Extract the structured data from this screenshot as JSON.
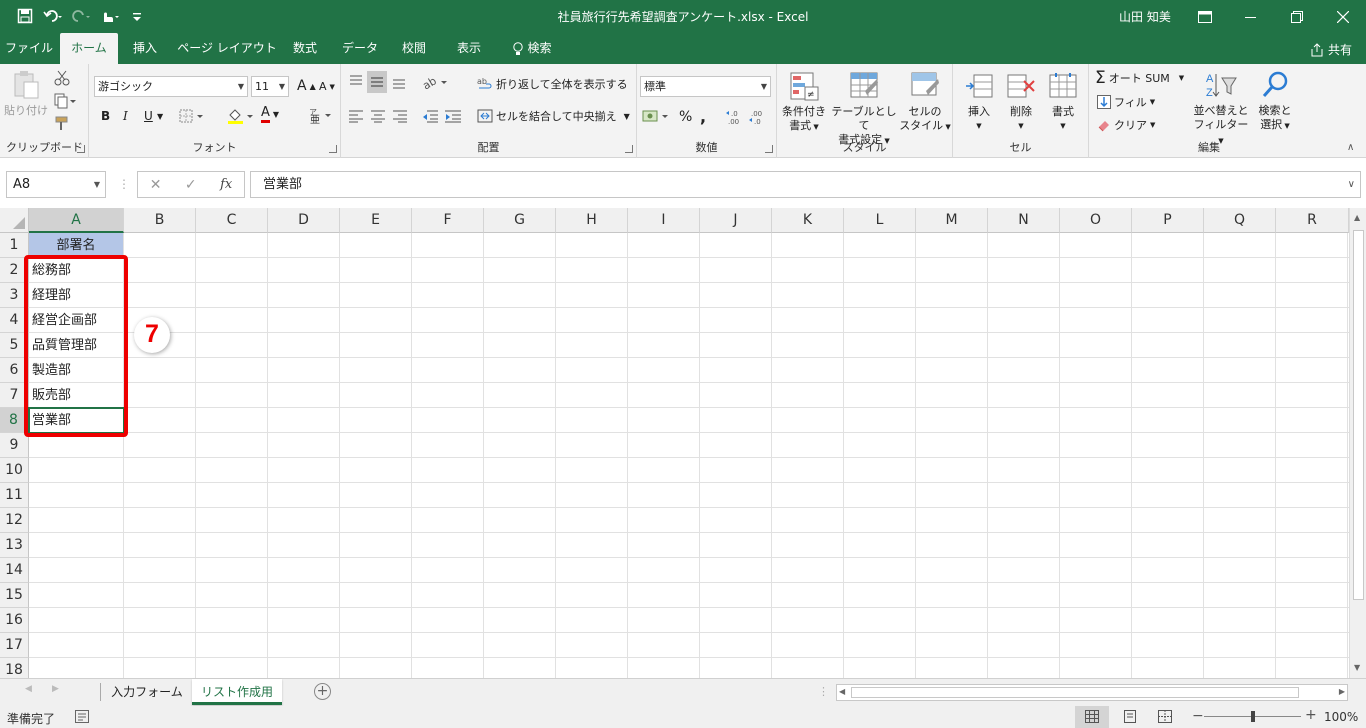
{
  "window": {
    "title": "社員旅行行先希望調査アンケート.xlsx  -  Excel",
    "user": "山田 知美",
    "share_label": "共有"
  },
  "tabs": [
    "ファイル",
    "ホーム",
    "挿入",
    "ページ レイアウト",
    "数式",
    "データ",
    "校閲",
    "表示",
    "検索"
  ],
  "ribbon": {
    "clipboard": {
      "label": "クリップボード",
      "paste": "貼り付け"
    },
    "font": {
      "label": "フォント",
      "name": "游ゴシック",
      "size": "11",
      "bold": "B",
      "italic": "I",
      "underline": "U",
      "grow": "A",
      "shrink": "A",
      "font_color": "A"
    },
    "alignment": {
      "label": "配置",
      "wrap": "折り返して全体を表示する",
      "merge": "セルを結合して中央揃え"
    },
    "number": {
      "label": "数値",
      "format": "標準",
      "percent": "%",
      "comma": ","
    },
    "styles": {
      "label": "スタイル",
      "conditional": [
        "条件付き",
        "書式"
      ],
      "table": [
        "テーブルとして",
        "書式設定"
      ],
      "cell_styles": [
        "セルの",
        "スタイル"
      ]
    },
    "cells": {
      "label": "セル",
      "insert": "挿入",
      "delete": "削除",
      "format": "書式"
    },
    "editing": {
      "label": "編集",
      "autosum": "オート SUM",
      "fill": "フィル",
      "clear": "クリア",
      "sort": [
        "並べ替えと",
        "フィルター"
      ],
      "find": [
        "検索と",
        "選択"
      ]
    }
  },
  "formula_bar": {
    "name_box": "A8",
    "fx": "fx",
    "content": "営業部"
  },
  "columns": [
    "A",
    "B",
    "C",
    "D",
    "E",
    "F",
    "G",
    "H",
    "I",
    "J",
    "K",
    "L",
    "M",
    "N",
    "O",
    "P",
    "Q",
    "R"
  ],
  "rows": [
    "1",
    "2",
    "3",
    "4",
    "5",
    "6",
    "7",
    "8",
    "9",
    "10",
    "11",
    "12",
    "13",
    "14",
    "15",
    "16",
    "17",
    "18"
  ],
  "cells": {
    "header": "部署名",
    "departments": [
      "総務部",
      "経理部",
      "経営企画部",
      "品質管理部",
      "製造部",
      "販売部",
      "営業部"
    ]
  },
  "callout": "7",
  "sheets": [
    "入力フォーム",
    "リスト作成用"
  ],
  "status": {
    "ready": "準備完了",
    "zoom": "100%"
  },
  "colors": {
    "excel_green": "#217346",
    "header_fill": "#b4c6e7",
    "highlight": "#ee0000"
  }
}
